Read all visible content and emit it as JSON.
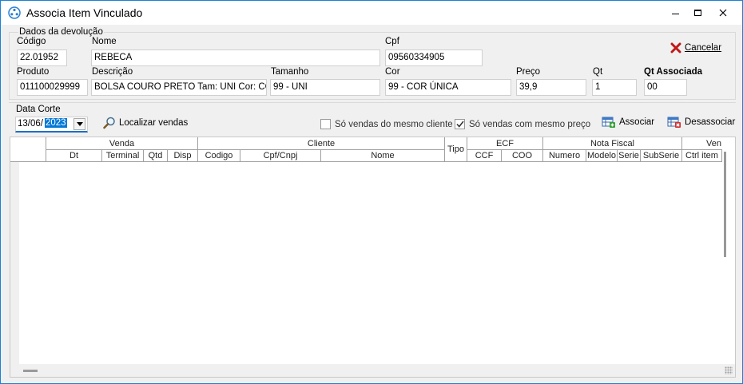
{
  "window": {
    "title": "Associa Item Vinculado",
    "controls": {
      "minimize": "minimize",
      "maximize": "maximize",
      "close": "close"
    }
  },
  "devolucao": {
    "group_title": "Dados da devolução",
    "codigo_label": "Código",
    "codigo_value": "22.01952",
    "nome_label": "Nome",
    "nome_value": "REBECA",
    "cpf_label": "Cpf",
    "cpf_value": "09560334905",
    "produto_label": "Produto",
    "produto_value": "011100029999",
    "descricao_label": "Descrição",
    "descricao_value": "BOLSA COURO PRETO Tam: UNI Cor: COR ÚNICA",
    "tamanho_label": "Tamanho",
    "tamanho_value": "99 - UNI",
    "cor_label": "Cor",
    "cor_value": "99 - COR ÚNICA",
    "preco_label": "Preço",
    "preco_value": "39,9",
    "qt_label": "Qt",
    "qt_value": "1",
    "qt_associada_label": "Qt Associada",
    "qt_associada_value": "00",
    "cancelar_label": "Cancelar"
  },
  "filtro": {
    "data_corte_label": "Data Corte",
    "data_corte_day_month": "13/06/",
    "data_corte_year": "2023",
    "localizar_label": "Localizar vendas",
    "mesmo_cliente_label": "Só vendas do mesmo cliente",
    "mesmo_cliente_checked": false,
    "mesmo_preco_label": "Só vendas com mesmo preço",
    "mesmo_preco_checked": true,
    "associar_label": "Associar",
    "desassociar_label": "Desassociar"
  },
  "grid": {
    "groups": {
      "venda": "Venda",
      "cliente": "Cliente",
      "tipo": "Tipo",
      "ecf": "ECF",
      "nota_fiscal": "Nota Fiscal",
      "ven": "Ven"
    },
    "columns": {
      "dt": "Dt",
      "terminal": "Terminal",
      "qtd": "Qtd",
      "disp": "Disp",
      "codigo": "Codigo",
      "cpf_cnpj": "Cpf/Cnpj",
      "nome": "Nome",
      "ccf": "CCF",
      "coo": "COO",
      "numero": "Numero",
      "modelo": "Modelo",
      "serie": "Serie",
      "subserie": "SubSerie",
      "ctrl_item": "Ctrl item"
    },
    "rows": []
  }
}
